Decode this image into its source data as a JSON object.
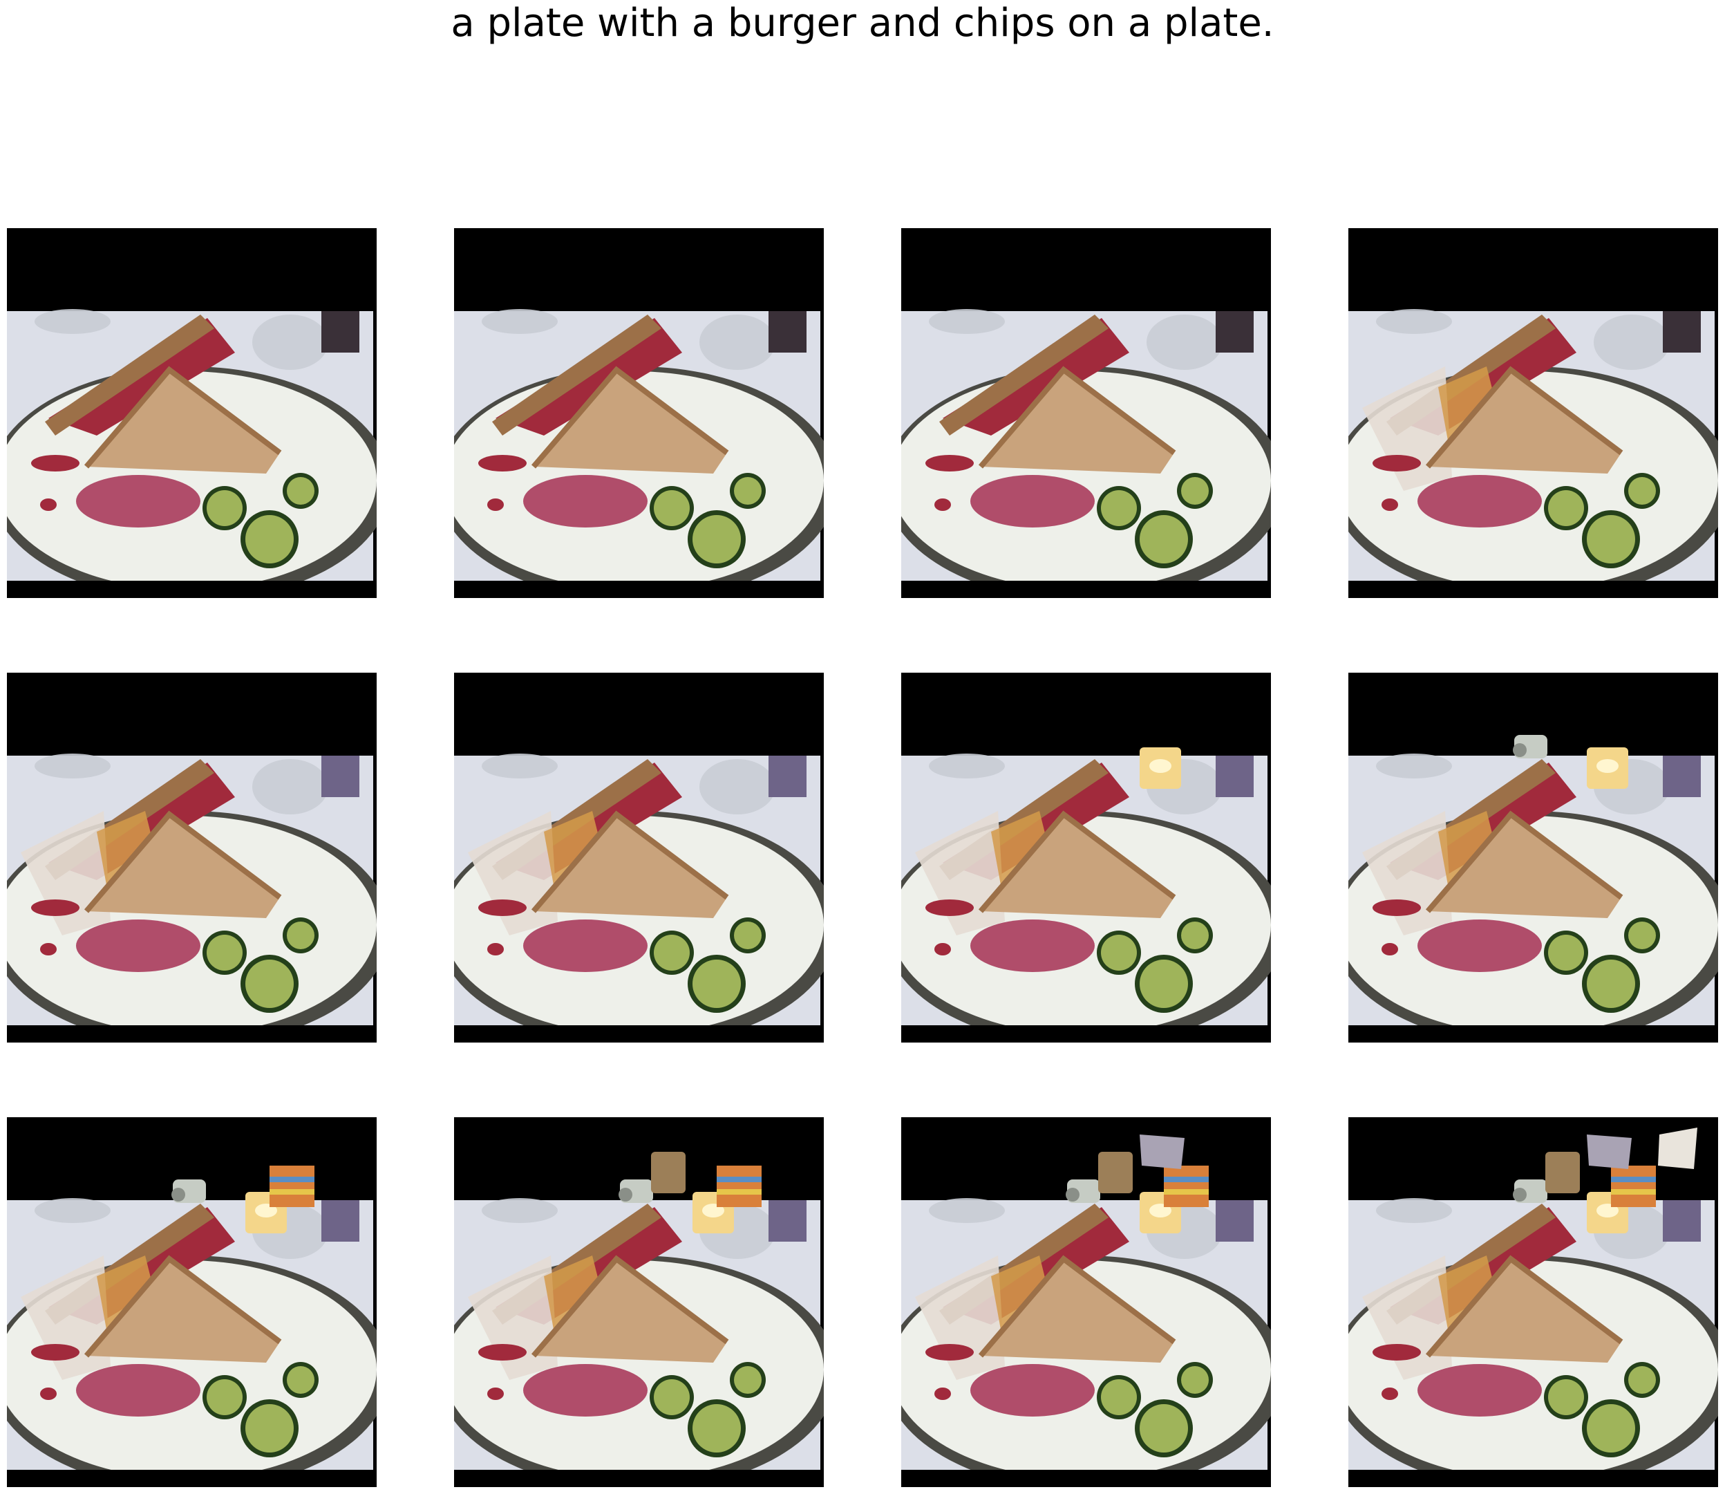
{
  "caption": "a plate with a burger and chips on a plate.",
  "grid": {
    "rows": 3,
    "cols": 4
  },
  "palette": {
    "background_black": "#000000",
    "tablecloth": "#dcdfe8",
    "plate": "#eef0ea",
    "plate_rim": "#4a4a44",
    "bread": "#c9a37c",
    "bread_crust": "#9c7048",
    "corned_beef": "#a12a3c",
    "beef_lighter": "#b04d6a",
    "cucumber": "#9fb45a",
    "cucumber_skin": "#24401a",
    "glass": "#c8ccd4",
    "wine": "#6e6488",
    "candle": "#f4d68a",
    "cup": "#c6ccc4",
    "tumbler": "#9c7f58",
    "striped_cup": "#d9803a",
    "napkin": "#e9e4dc"
  },
  "frames": [
    {
      "index": 1,
      "extras": []
    },
    {
      "index": 2,
      "extras": []
    },
    {
      "index": 3,
      "extras": []
    },
    {
      "index": 4,
      "extras": [
        "extra-sandwich"
      ]
    },
    {
      "index": 5,
      "extras": [
        "extra-sandwich",
        "wine-glass-purple"
      ]
    },
    {
      "index": 6,
      "extras": [
        "extra-sandwich",
        "wine-glass-purple"
      ]
    },
    {
      "index": 7,
      "extras": [
        "extra-sandwich",
        "wine-glass-purple",
        "candle"
      ]
    },
    {
      "index": 8,
      "extras": [
        "extra-sandwich",
        "wine-glass-purple",
        "candle",
        "cup"
      ]
    },
    {
      "index": 9,
      "extras": [
        "extra-sandwich",
        "wine-glass-purple",
        "candle",
        "cup",
        "striped-cup"
      ]
    },
    {
      "index": 10,
      "extras": [
        "extra-sandwich",
        "wine-glass-purple",
        "candle",
        "cup",
        "striped-cup",
        "tumbler"
      ]
    },
    {
      "index": 11,
      "extras": [
        "extra-sandwich",
        "wine-glass-purple",
        "candle",
        "cup",
        "striped-cup",
        "tumbler",
        "grey-block"
      ]
    },
    {
      "index": 12,
      "extras": [
        "extra-sandwich",
        "wine-glass-purple",
        "candle",
        "cup",
        "striped-cup",
        "tumbler",
        "grey-block",
        "napkin"
      ]
    }
  ]
}
